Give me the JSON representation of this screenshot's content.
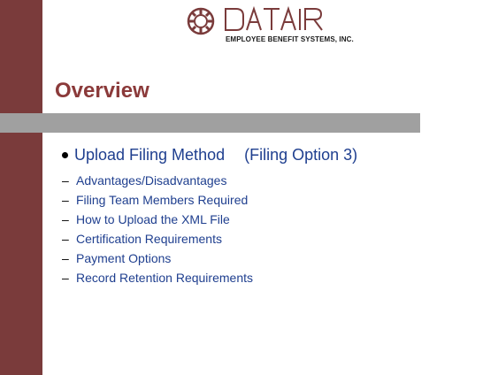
{
  "slide": {
    "logo": {
      "wordmark": "DATAIR",
      "company": "EMPLOYEE BENEFIT SYSTEMS, INC."
    },
    "title": "Overview",
    "main_bullet": {
      "text": "Upload Filing Method",
      "note": "(Filing Option 3)"
    },
    "sub_bullets": [
      "Advantages/Disadvantages",
      "Filing Team Members Required",
      "How to Upload the XML File",
      "Certification Requirements",
      "Payment Options",
      "Record Retention Requirements"
    ],
    "colors": {
      "accent_band": "#7a3b3b",
      "title": "#8b3a3a",
      "bar": "#a0a0a0",
      "body_text": "#1f3f8f"
    }
  }
}
